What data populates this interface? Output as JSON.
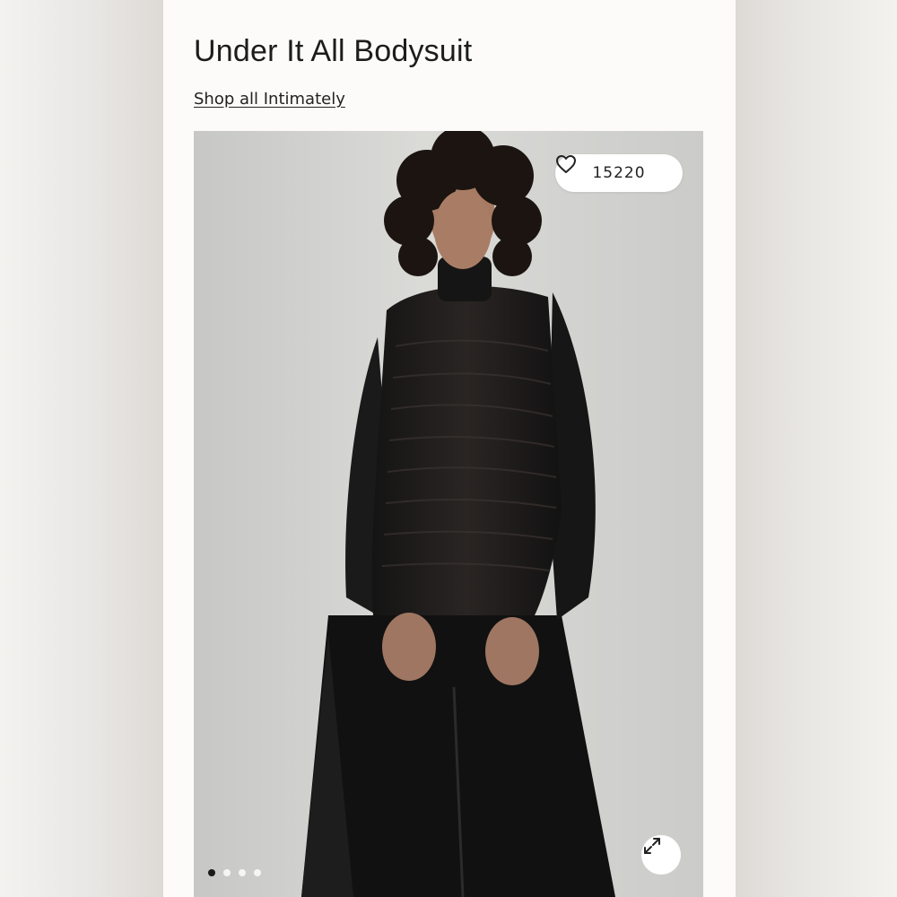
{
  "product": {
    "title": "Under It All Bodysuit",
    "shop_link": "Shop all Intimately"
  },
  "gallery": {
    "like_count": "15220",
    "slides": 4,
    "active_slide": 1,
    "icons": {
      "like": "heart-icon",
      "expand": "expand-icon"
    }
  },
  "colors": {
    "background": "#fdfbf9",
    "text": "#1c1c1c",
    "dot_active": "#1a1a1a",
    "dot_inactive": "#f5f5f5"
  }
}
